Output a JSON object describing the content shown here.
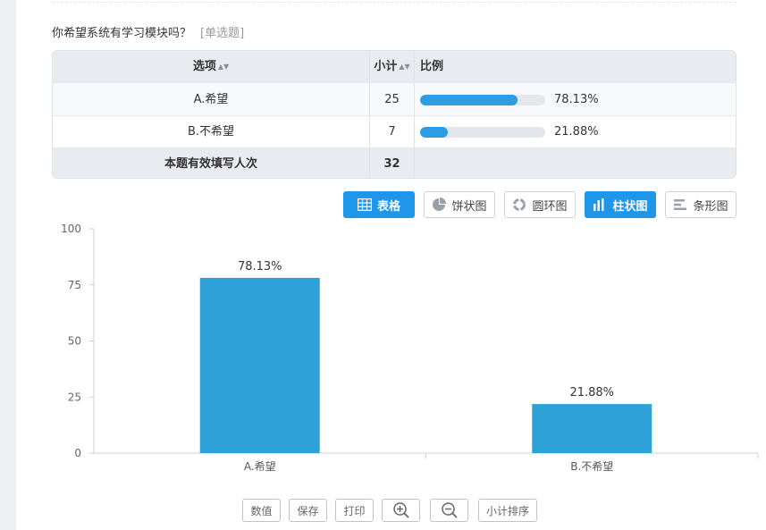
{
  "question": {
    "title": "你希望系统有学习模块吗？",
    "type": "[单选题]"
  },
  "table": {
    "headers": {
      "option": "选项",
      "count": "小计",
      "ratio": "比例"
    },
    "rows": [
      {
        "option": "A.希望",
        "count": "25",
        "ratio": "78.13%",
        "ratio_value": 78.13
      },
      {
        "option": "B.不希望",
        "count": "7",
        "ratio": "21.88%",
        "ratio_value": 21.88
      }
    ],
    "total": {
      "label": "本题有效填写人次",
      "count": "32"
    }
  },
  "chart_types": {
    "table": "表格",
    "pie": "饼状图",
    "ring": "圆环图",
    "column": "柱状图",
    "bar": "条形图",
    "active": "column"
  },
  "chart_data": {
    "type": "bar",
    "categories": [
      "A.希望",
      "B.不希望"
    ],
    "values": [
      78.13,
      21.88
    ],
    "labels": [
      "78.13%",
      "21.88%"
    ],
    "ylim": [
      0,
      100
    ],
    "yticks": [
      0,
      25,
      50,
      75,
      100
    ],
    "bar_color": "#2ea1d8",
    "grid": false
  },
  "tools": {
    "values": "数值",
    "save": "保存",
    "print": "打印",
    "sort": "小计排序"
  },
  "colors": {
    "accent": "#1e97ea",
    "progress": "#2d9de3"
  }
}
